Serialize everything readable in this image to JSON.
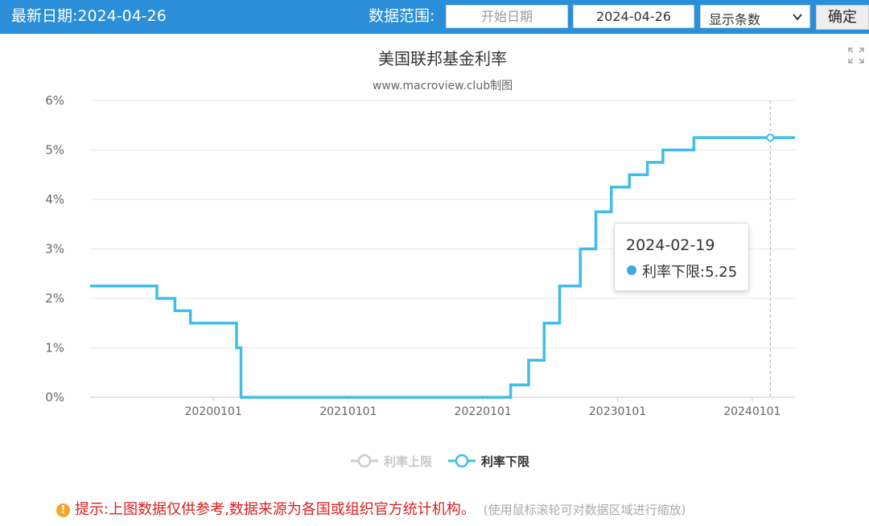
{
  "header": {
    "latest_label": "最新日期:",
    "latest_date": "2024-04-26",
    "range_label": "数据范围:",
    "start_placeholder": "开始日期",
    "end_value": "2024-04-26",
    "count_select": "显示条数",
    "confirm_label": "确定"
  },
  "tooltip": {
    "date": "2024-02-19",
    "series": "利率下限",
    "value": "5.25"
  },
  "footer": {
    "note": "提示:上图数据仅供参考,数据来源为各国或组织官方统计机构。",
    "hint": "(使用鼠标滚轮可对数据区域进行缩放)"
  },
  "colors": {
    "header_bg": "#2a8fd8",
    "line": "#40bde8",
    "note_text": "#d92020",
    "warn_icon": "#f5a623"
  },
  "icons": [
    "chevron-down-icon",
    "expand-icon",
    "warning-icon"
  ],
  "chart_data": {
    "type": "line",
    "title": "美国联邦基金利率",
    "subtitle": "www.macroview.club制图",
    "x_ticks": [
      "20200101",
      "20210101",
      "20220101",
      "20230101",
      "20240101"
    ],
    "y_ticks": [
      "0%",
      "1%",
      "2%",
      "3%",
      "4%",
      "5%",
      "6%"
    ],
    "ylim": [
      0,
      6
    ],
    "x_range": [
      "2019-02-01",
      "2024-04-26"
    ],
    "grid": true,
    "legend_position": "bottom",
    "series": [
      {
        "name": "利率上限",
        "visible": false,
        "points": []
      },
      {
        "name": "利率下限",
        "visible": true,
        "step": true,
        "points": [
          [
            "2019-02-01",
            2.25
          ],
          [
            "2019-08-01",
            2.0
          ],
          [
            "2019-09-19",
            1.75
          ],
          [
            "2019-10-31",
            1.5
          ],
          [
            "2020-03-04",
            1.0
          ],
          [
            "2020-03-16",
            0.0
          ],
          [
            "2022-03-17",
            0.25
          ],
          [
            "2022-05-05",
            0.75
          ],
          [
            "2022-06-16",
            1.5
          ],
          [
            "2022-07-28",
            2.25
          ],
          [
            "2022-09-22",
            3.0
          ],
          [
            "2022-11-03",
            3.75
          ],
          [
            "2022-12-15",
            4.25
          ],
          [
            "2023-02-02",
            4.5
          ],
          [
            "2023-03-23",
            4.75
          ],
          [
            "2023-05-04",
            5.0
          ],
          [
            "2023-07-27",
            5.25
          ],
          [
            "2024-04-26",
            5.25
          ]
        ]
      }
    ],
    "highlight": {
      "date": "2024-02-19",
      "value": 5.25
    }
  }
}
